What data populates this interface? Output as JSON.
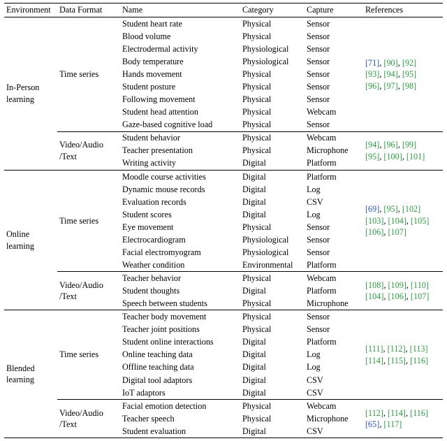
{
  "headers": {
    "env": "Environment",
    "fmt": "Data Format",
    "name": "Name",
    "cat": "Category",
    "cap": "Capture",
    "ref": "References"
  },
  "environments": [
    {
      "label": "In-Person\nlearning",
      "blocks": [
        {
          "fmt": "Time series",
          "rows": [
            {
              "name": "Student heart rate",
              "cat": "Physical",
              "cap": "Sensor"
            },
            {
              "name": "Blood volume",
              "cat": "Physical",
              "cap": "Sensor"
            },
            {
              "name": "Electrodermal activity",
              "cat": "Physiological",
              "cap": "Sensor"
            },
            {
              "name": "Body temperature",
              "cat": "Physiological",
              "cap": "Sensor"
            },
            {
              "name": "Hands movement",
              "cat": "Physical",
              "cap": "Sensor"
            },
            {
              "name": "Student posture",
              "cat": "Physical",
              "cap": "Sensor"
            },
            {
              "name": "Following movement",
              "cat": "Physical",
              "cap": "Sensor"
            },
            {
              "name": "Student head attention",
              "cat": "Physical",
              "cap": "Webcam"
            },
            {
              "name": "Gaze-based cognitive load",
              "cat": "Physical",
              "cap": "Sensor"
            }
          ],
          "refs": [
            [
              {
                "t": "[71]",
                "c": "blue"
              },
              {
                "t": ", "
              },
              {
                "t": "[90]",
                "c": "g"
              },
              {
                "t": ", "
              },
              {
                "t": "[92]",
                "c": "g"
              }
            ],
            [
              {
                "t": "[93]",
                "c": "g"
              },
              {
                "t": ", "
              },
              {
                "t": "[94]",
                "c": "g"
              },
              {
                "t": ", "
              },
              {
                "t": "[95]",
                "c": "g"
              }
            ],
            [
              {
                "t": "[96]",
                "c": "g"
              },
              {
                "t": ", "
              },
              {
                "t": "[97]",
                "c": "g"
              },
              {
                "t": ", "
              },
              {
                "t": "[98]",
                "c": "g"
              }
            ]
          ]
        },
        {
          "fmt": "Video/Audio\n/Text",
          "rows": [
            {
              "name": "Student behavior",
              "cat": "Physical",
              "cap": "Webcam"
            },
            {
              "name": "Teacher presentation",
              "cat": "Physical",
              "cap": "Microphone"
            },
            {
              "name": "Writing activity",
              "cat": "Digital",
              "cap": "Platform"
            }
          ],
          "refs": [
            [
              {
                "t": "[94]",
                "c": "g"
              },
              {
                "t": ", "
              },
              {
                "t": "[96]",
                "c": "g"
              },
              {
                "t": ", "
              },
              {
                "t": "[99]",
                "c": "g"
              }
            ],
            [
              {
                "t": "[95]",
                "c": "g"
              },
              {
                "t": ", "
              },
              {
                "t": "[100]",
                "c": "g"
              },
              {
                "t": ", "
              },
              {
                "t": "[101]",
                "c": "g"
              }
            ]
          ]
        }
      ]
    },
    {
      "label": "Online\nlearning",
      "blocks": [
        {
          "fmt": "Time series",
          "rows": [
            {
              "name": "Moodle course activities",
              "cat": "Digital",
              "cap": "Platform"
            },
            {
              "name": "Dynamic mouse records",
              "cat": "Digital",
              "cap": "Log"
            },
            {
              "name": "Evaluation records",
              "cat": "Digital",
              "cap": "CSV"
            },
            {
              "name": "Student scores",
              "cat": "Digital",
              "cap": "Log"
            },
            {
              "name": "Eye movement",
              "cat": "Physical",
              "cap": "Sensor"
            },
            {
              "name": "Electrocardiogram",
              "cat": "Physiological",
              "cap": "Sensor"
            },
            {
              "name": "Facial electromyogram",
              "cat": "Physiological",
              "cap": "Sensor"
            },
            {
              "name": "Weather condition",
              "cat": "Environmental",
              "cap": "Platform"
            }
          ],
          "refs": [
            [
              {
                "t": "[69]",
                "c": "blue"
              },
              {
                "t": ", "
              },
              {
                "t": "[95]",
                "c": "g"
              },
              {
                "t": ", "
              },
              {
                "t": "[102]",
                "c": "g"
              }
            ],
            [
              {
                "t": "[103]",
                "c": "g"
              },
              {
                "t": ", "
              },
              {
                "t": "[104]",
                "c": "g"
              },
              {
                "t": ", "
              },
              {
                "t": "[105]",
                "c": "g"
              }
            ],
            [
              {
                "t": "[106]",
                "c": "g"
              },
              {
                "t": ", "
              },
              {
                "t": "[107]",
                "c": "g"
              }
            ]
          ]
        },
        {
          "fmt": "Video/Audio\n/Text",
          "rows": [
            {
              "name": "Teacher behavior",
              "cat": "Physical",
              "cap": "Webcam"
            },
            {
              "name": "Student thoughts",
              "cat": "Digital",
              "cap": "Platform"
            },
            {
              "name": "Speech between students",
              "cat": "Physical",
              "cap": "Microphone"
            }
          ],
          "refs": [
            [
              {
                "t": "[108]",
                "c": "g"
              },
              {
                "t": ", "
              },
              {
                "t": "[109]",
                "c": "g"
              },
              {
                "t": ", "
              },
              {
                "t": "[110]",
                "c": "g"
              }
            ],
            [
              {
                "t": "[104]",
                "c": "g"
              },
              {
                "t": ", "
              },
              {
                "t": "[106]",
                "c": "g"
              },
              {
                "t": ", "
              },
              {
                "t": "[107]",
                "c": "g"
              }
            ]
          ]
        }
      ]
    },
    {
      "label": "Blended\nlearning",
      "blocks": [
        {
          "fmt": "Time series",
          "rows": [
            {
              "name": "Teacher body movement",
              "cat": "Physical",
              "cap": "Sensor"
            },
            {
              "name": "Teacher joint positions",
              "cat": "Physical",
              "cap": "Sensor"
            },
            {
              "name": "Student online interactions",
              "cat": "Digital",
              "cap": "Platform"
            },
            {
              "name": "Online teaching data",
              "cat": "Digital",
              "cap": "Log"
            },
            {
              "name": "Offline teaching data",
              "cat": "Digital",
              "cap": "Log"
            },
            {
              "name": "Digital tool adaptors",
              "cat": "Digital",
              "cap": "CSV"
            },
            {
              "name": "IoT adaptors",
              "cat": "Digital",
              "cap": "CSV"
            }
          ],
          "refs": [
            [
              {
                "t": "[111]",
                "c": "g"
              },
              {
                "t": ", "
              },
              {
                "t": "[112]",
                "c": "g"
              },
              {
                "t": ", "
              },
              {
                "t": "[113]",
                "c": "g"
              }
            ],
            [
              {
                "t": "[114]",
                "c": "g"
              },
              {
                "t": ", "
              },
              {
                "t": "[115]",
                "c": "g"
              },
              {
                "t": ", "
              },
              {
                "t": "[116]",
                "c": "g"
              }
            ]
          ]
        },
        {
          "fmt": "Video/Audio\n/Text",
          "rows": [
            {
              "name": "Facial emotion detection",
              "cat": "Physical",
              "cap": "Webcam"
            },
            {
              "name": "Teacher speech",
              "cat": "Physical",
              "cap": "Microphone"
            },
            {
              "name": "Student evaluation",
              "cat": "Digital",
              "cap": "CSV"
            }
          ],
          "refs": [
            [
              {
                "t": "[112]",
                "c": "g"
              },
              {
                "t": ", "
              },
              {
                "t": "[114]",
                "c": "g"
              },
              {
                "t": ", "
              },
              {
                "t": "[116]",
                "c": "g"
              }
            ],
            [
              {
                "t": "[65]",
                "c": "blue"
              },
              {
                "t": ", "
              },
              {
                "t": "[117]",
                "c": "g"
              }
            ]
          ]
        }
      ]
    }
  ]
}
